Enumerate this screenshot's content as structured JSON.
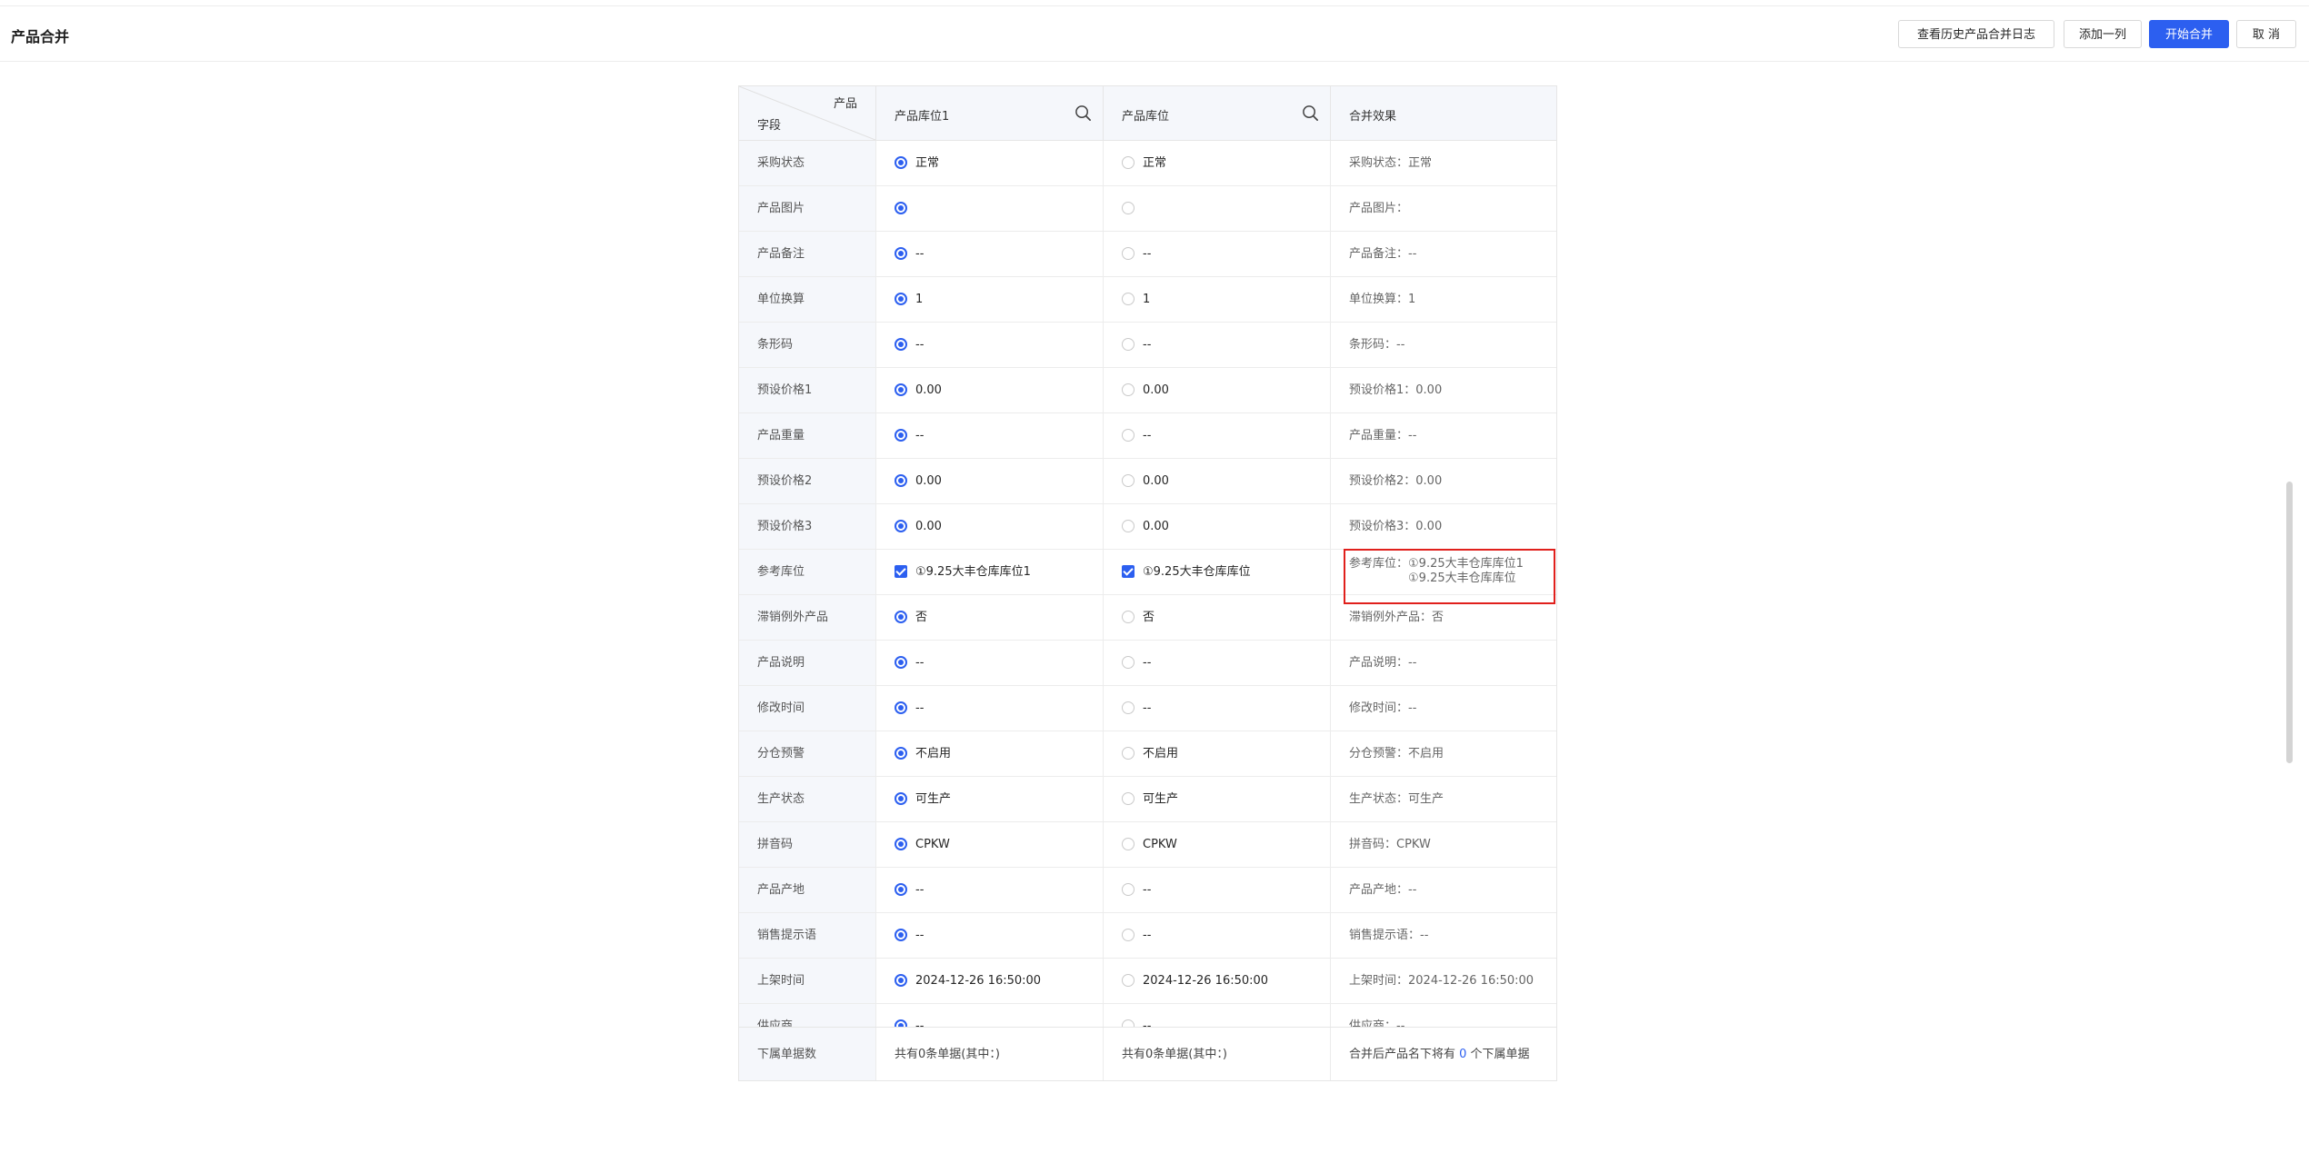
{
  "page": {
    "title": "产品合并"
  },
  "toolbar": {
    "history_label": "查看历史产品合并日志",
    "add_column_label": "添加一列",
    "start_merge_label": "开始合并",
    "cancel_label": "取 消"
  },
  "table": {
    "corner": {
      "top": "产品",
      "bottom": "字段"
    },
    "columns": [
      {
        "label": "产品库位1"
      },
      {
        "label": "产品库位"
      },
      {
        "label": "合并效果"
      }
    ],
    "rows": [
      {
        "field": "采购状态",
        "c1": "正常",
        "c2": "正常",
        "merge": "采购状态：正常"
      },
      {
        "field": "产品图片",
        "c1": "",
        "c2": "",
        "merge": "产品图片："
      },
      {
        "field": "产品备注",
        "c1": "--",
        "c2": "--",
        "merge": "产品备注：--"
      },
      {
        "field": "单位换算",
        "c1": "1",
        "c2": "1",
        "merge": "单位换算：1"
      },
      {
        "field": "条形码",
        "c1": "--",
        "c2": "--",
        "merge": "条形码：--"
      },
      {
        "field": "预设价格1",
        "c1": "0.00",
        "c2": "0.00",
        "merge": "预设价格1：0.00"
      },
      {
        "field": "产品重量",
        "c1": "--",
        "c2": "--",
        "merge": "产品重量：--"
      },
      {
        "field": "预设价格2",
        "c1": "0.00",
        "c2": "0.00",
        "merge": "预设价格2：0.00"
      },
      {
        "field": "预设价格3",
        "c1": "0.00",
        "c2": "0.00",
        "merge": "预设价格3：0.00"
      },
      {
        "field": "参考库位",
        "c1": "①9.25大丰仓库库位1",
        "c2": "①9.25大丰仓库库位",
        "merge_label": "参考库位：",
        "merge_line1": "①9.25大丰仓库库位1",
        "merge_line2": "①9.25大丰仓库库位"
      },
      {
        "field": "滞销例外产品",
        "c1": "否",
        "c2": "否",
        "merge": "滞销例外产品：否"
      },
      {
        "field": "产品说明",
        "c1": "--",
        "c2": "--",
        "merge": "产品说明：--"
      },
      {
        "field": "修改时间",
        "c1": "--",
        "c2": "--",
        "merge": "修改时间：--"
      },
      {
        "field": "分仓预警",
        "c1": "不启用",
        "c2": "不启用",
        "merge": "分仓预警：不启用"
      },
      {
        "field": "生产状态",
        "c1": "可生产",
        "c2": "可生产",
        "merge": "生产状态：可生产"
      },
      {
        "field": "拼音码",
        "c1": "CPKW",
        "c2": "CPKW",
        "merge": "拼音码：CPKW"
      },
      {
        "field": "产品产地",
        "c1": "--",
        "c2": "--",
        "merge": "产品产地：--"
      },
      {
        "field": "销售提示语",
        "c1": "--",
        "c2": "--",
        "merge": "销售提示语：--"
      },
      {
        "field": "上架时间",
        "c1": "2024-12-26 16:50:00",
        "c2": "2024-12-26 16:50:00",
        "merge": "上架时间：2024-12-26 16:50:00"
      },
      {
        "field": "供应商",
        "c1": "--",
        "c2": "--",
        "merge": "供应商：--"
      }
    ],
    "footer": {
      "field": "下属单据数",
      "c1": "共有0条单据(其中：)",
      "c2": "共有0条单据(其中：)",
      "merge_prefix": "合并后产品名下将有 ",
      "merge_count": "0",
      "merge_suffix": " 个下属单据"
    }
  },
  "icons": {
    "search": "search-icon"
  },
  "colors": {
    "primary": "#2c5ff0",
    "highlight": "#e0201c"
  }
}
